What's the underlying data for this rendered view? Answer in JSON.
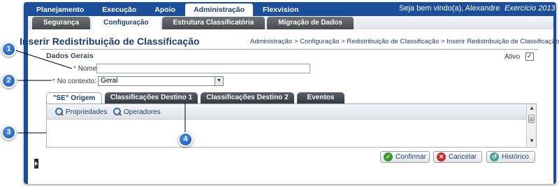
{
  "nav": {
    "main_tabs": [
      "Planejamento",
      "Execução",
      "Apoio",
      "Administração",
      "Flexvision"
    ],
    "active_main": "Administração",
    "welcome": "Seja bem vindo(a), Alexandre",
    "exercicio": "Exercício 2013"
  },
  "subnav": {
    "tabs": [
      "Segurança",
      "Configuração",
      "Estrutura Classificatória",
      "Migração de Dados"
    ],
    "active": "Configuração"
  },
  "page": {
    "title": "Inserir Redistribuição de Classificação",
    "breadcrumb": "Administração > Configuração > Redistribuição de Classificação > Inserir Redistribuição de Classificação"
  },
  "form": {
    "section_title": "Dados Gerais",
    "ativo_label": "Ativo",
    "ativo_checked": true,
    "required_mark": "*",
    "nome_label": "Nome",
    "nome_value": "",
    "contexto_label": "No contexto:",
    "contexto_value": "Geral"
  },
  "inner_tabs": [
    "\"SE\" Origem",
    "Classificações Destino 1",
    "Classificações Destino 2",
    "Eventos"
  ],
  "active_inner_tab": "\"SE\" Origem",
  "panel_toolbar": {
    "propriedades": "Propriedades",
    "operadores": "Operadores"
  },
  "buttons": {
    "confirmar": "Confirmar",
    "cancelar": "Cancelar",
    "historico": "Histórico"
  },
  "callouts": [
    "1",
    "2",
    "3",
    "4"
  ],
  "colors": {
    "frame": "#1b4f9c",
    "title": "#1d3e75",
    "callout": "#1558b8",
    "required": "#d32f2f"
  }
}
